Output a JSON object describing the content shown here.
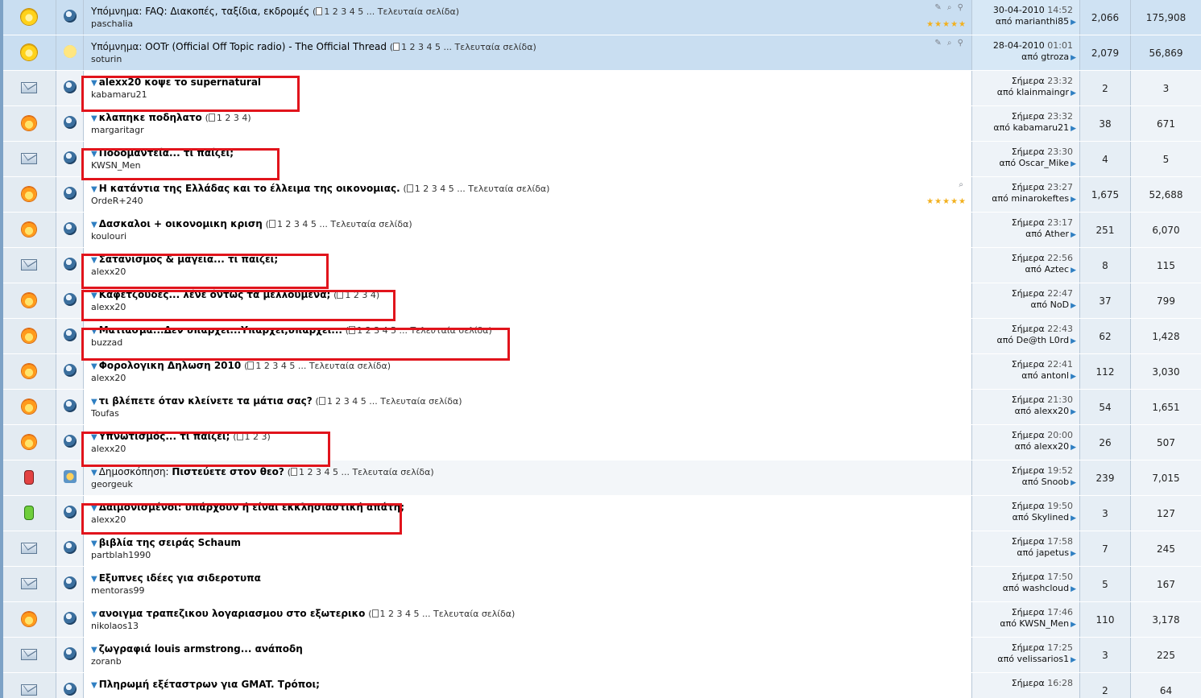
{
  "rows": [
    {
      "status": "sticky",
      "posticon": "normal",
      "prefix": "Υπόμνημα: ",
      "title": "FAQ: Διακοπές, ταξίδια, εκδρομές",
      "bold": false,
      "arrow": false,
      "pages": "1 2 3 4 5 ... Τελευταία σελίδα",
      "author": "paschalia",
      "stars": "★★★★★",
      "flags": "✎ ⌕ ⚲",
      "date": "30-04-2010",
      "time": "14:52",
      "by": "από marianthi85",
      "replies": "2,066",
      "views": "175,908"
    },
    {
      "status": "sticky",
      "posticon": "smile",
      "prefix": "Υπόμνημα: ",
      "title": "OOTr (Official Off Topic radio) - The Official Thread",
      "bold": false,
      "arrow": false,
      "pages": "1 2 3 4 5 ... Τελευταία σελίδα",
      "author": "soturin",
      "stars": "",
      "flags": "✎ ⌕ ⚲",
      "date": "28-04-2010",
      "time": "01:01",
      "by": "από gtroza",
      "replies": "2,079",
      "views": "56,869"
    },
    {
      "status": "mail",
      "posticon": "normal",
      "prefix": "",
      "title": "alexx20 κοψε το supernatural",
      "bold": true,
      "arrow": true,
      "pages": "",
      "author": "kabamaru21",
      "stars": "",
      "flags": "",
      "date": "Σήμερα",
      "time": "23:32",
      "by": "από klainmaingr",
      "replies": "2",
      "views": "3"
    },
    {
      "status": "hot",
      "posticon": "normal",
      "prefix": "",
      "title": "κλαπηκε ποδηλατο",
      "bold": true,
      "arrow": true,
      "pages": "1 2 3 4",
      "author": "margaritagr",
      "stars": "",
      "flags": "",
      "date": "Σήμερα",
      "time": "23:32",
      "by": "από kabamaru21",
      "replies": "38",
      "views": "671"
    },
    {
      "status": "mail",
      "posticon": "normal",
      "prefix": "",
      "title": "Ποδομαντεία... τι παίζει;",
      "bold": true,
      "arrow": true,
      "pages": "",
      "author": "KWSN_Men",
      "stars": "",
      "flags": "",
      "date": "Σήμερα",
      "time": "23:30",
      "by": "από Oscar_Mike",
      "replies": "4",
      "views": "5"
    },
    {
      "status": "hot",
      "posticon": "normal",
      "prefix": "",
      "title": "Η κατάντια της Ελλάδας και το έλλειμα της οικονομιας.",
      "bold": true,
      "arrow": true,
      "pages": "1 2 3 4 5 ... Τελευταία σελίδα",
      "author": "OrdeR+240",
      "stars": "★★★★★",
      "flags": "⌕",
      "date": "Σήμερα",
      "time": "23:27",
      "by": "από minarokeftes",
      "replies": "1,675",
      "views": "52,688"
    },
    {
      "status": "hot",
      "posticon": "normal",
      "prefix": "",
      "title": "Δασκαλοι + οικονομικη κριση",
      "bold": true,
      "arrow": true,
      "pages": "1 2 3 4 5 ... Τελευταία σελίδα",
      "author": "koulouri",
      "stars": "",
      "flags": "",
      "date": "Σήμερα",
      "time": "23:17",
      "by": "από Ather",
      "replies": "251",
      "views": "6,070"
    },
    {
      "status": "mail",
      "posticon": "normal",
      "prefix": "",
      "title": "Σατανισμός & μαγεία... τι παίζει;",
      "bold": true,
      "arrow": true,
      "pages": "",
      "author": "alexx20",
      "stars": "",
      "flags": "",
      "date": "Σήμερα",
      "time": "22:56",
      "by": "από Aztec",
      "replies": "8",
      "views": "115"
    },
    {
      "status": "hot",
      "posticon": "normal",
      "prefix": "",
      "title": "Καφετζούδες... λένε όντως τα μελλούμενα;",
      "bold": true,
      "arrow": true,
      "pages": "1 2 3 4",
      "author": "alexx20",
      "stars": "",
      "flags": "",
      "date": "Σήμερα",
      "time": "22:47",
      "by": "από NoD",
      "replies": "37",
      "views": "799"
    },
    {
      "status": "hot",
      "posticon": "normal",
      "prefix": "",
      "title": "Ματιασμα...Δεν υπαρχει...Υπαρχει,υπαρχει...",
      "bold": true,
      "arrow": true,
      "pages": "1 2 3 4 5 ... Τελευταία σελίδα",
      "author": "buzzad",
      "stars": "",
      "flags": "",
      "date": "Σήμερα",
      "time": "22:43",
      "by": "από De@th L0rd",
      "replies": "62",
      "views": "1,428"
    },
    {
      "status": "hot",
      "posticon": "normal",
      "prefix": "",
      "title": "Φορολογικη Δηλωση 2010",
      "bold": true,
      "arrow": true,
      "pages": "1 2 3 4 5 ... Τελευταία σελίδα",
      "author": "alexx20",
      "stars": "",
      "flags": "",
      "date": "Σήμερα",
      "time": "22:41",
      "by": "από antonl",
      "replies": "112",
      "views": "3,030"
    },
    {
      "status": "hot",
      "posticon": "normal",
      "prefix": "",
      "title": "τι βλέπετε όταν κλείνετε τα μάτια σας?",
      "bold": true,
      "arrow": true,
      "pages": "1 2 3 4 5 ... Τελευταία σελίδα",
      "author": "Toufas",
      "stars": "",
      "flags": "",
      "date": "Σήμερα",
      "time": "21:30",
      "by": "από alexx20",
      "replies": "54",
      "views": "1,651"
    },
    {
      "status": "hot",
      "posticon": "normal",
      "prefix": "",
      "title": "Υπνωτισμός... τι παίζει;",
      "bold": true,
      "arrow": true,
      "pages": "1 2 3",
      "author": "alexx20",
      "stars": "",
      "flags": "",
      "date": "Σήμερα",
      "time": "20:00",
      "by": "από alexx20",
      "replies": "26",
      "views": "507"
    },
    {
      "status": "lock-red",
      "posticon": "poll",
      "prefix": "Δημοσκόπηση: ",
      "title": "Πιστεύετε στον θεο?",
      "bold": true,
      "arrow": true,
      "pages": "1 2 3 4 5 ... Τελευταία σελίδα",
      "author": "georgeuk",
      "stars": "",
      "flags": "",
      "date": "Σήμερα",
      "time": "19:52",
      "by": "από Snoob",
      "replies": "239",
      "views": "7,015"
    },
    {
      "status": "lock-green",
      "posticon": "normal",
      "prefix": "",
      "title": "Δαιμονισμένοι: υπάρχουν ή είναι εκκλησιαστική απάτη;",
      "bold": true,
      "arrow": true,
      "pages": "",
      "author": "alexx20",
      "stars": "",
      "flags": "",
      "date": "Σήμερα",
      "time": "19:50",
      "by": "από Skylined",
      "replies": "3",
      "views": "127"
    },
    {
      "status": "mail",
      "posticon": "normal",
      "prefix": "",
      "title": "βιβλία της σειράς Schaum",
      "bold": true,
      "arrow": true,
      "pages": "",
      "author": "partblah1990",
      "stars": "",
      "flags": "",
      "date": "Σήμερα",
      "time": "17:58",
      "by": "από japetus",
      "replies": "7",
      "views": "245"
    },
    {
      "status": "mail",
      "posticon": "normal",
      "prefix": "",
      "title": "Εξυπνες ιδέες για σιδερoτυπα",
      "bold": true,
      "arrow": true,
      "pages": "",
      "author": "mentoras99",
      "stars": "",
      "flags": "",
      "date": "Σήμερα",
      "time": "17:50",
      "by": "από washcloud",
      "replies": "5",
      "views": "167"
    },
    {
      "status": "hot",
      "posticon": "normal",
      "prefix": "",
      "title": "ανοιγμα τραπεζικου λογαριασμου στο εξωτερικο",
      "bold": true,
      "arrow": true,
      "pages": "1 2 3 4 5 ... Τελευταία σελίδα",
      "author": "nikolaos13",
      "stars": "",
      "flags": "",
      "date": "Σήμερα",
      "time": "17:46",
      "by": "από KWSN_Men",
      "replies": "110",
      "views": "3,178"
    },
    {
      "status": "mail",
      "posticon": "normal",
      "prefix": "",
      "title": "ζωγραφιά louis armstrong... ανάποδη",
      "bold": true,
      "arrow": true,
      "pages": "",
      "author": "zoranb",
      "stars": "",
      "flags": "",
      "date": "Σήμερα",
      "time": "17:25",
      "by": "από velissarios1",
      "replies": "3",
      "views": "225"
    },
    {
      "status": "mail",
      "posticon": "normal",
      "prefix": "",
      "title": "Πληρωμή εξέταστρων για GMAT. Τρόποι;",
      "bold": true,
      "arrow": true,
      "pages": "",
      "author": "",
      "stars": "",
      "flags": "",
      "date": "Σήμερα",
      "time": "16:28",
      "by": "",
      "replies": "2",
      "views": "64"
    }
  ],
  "highlight_color": "#e1141c"
}
